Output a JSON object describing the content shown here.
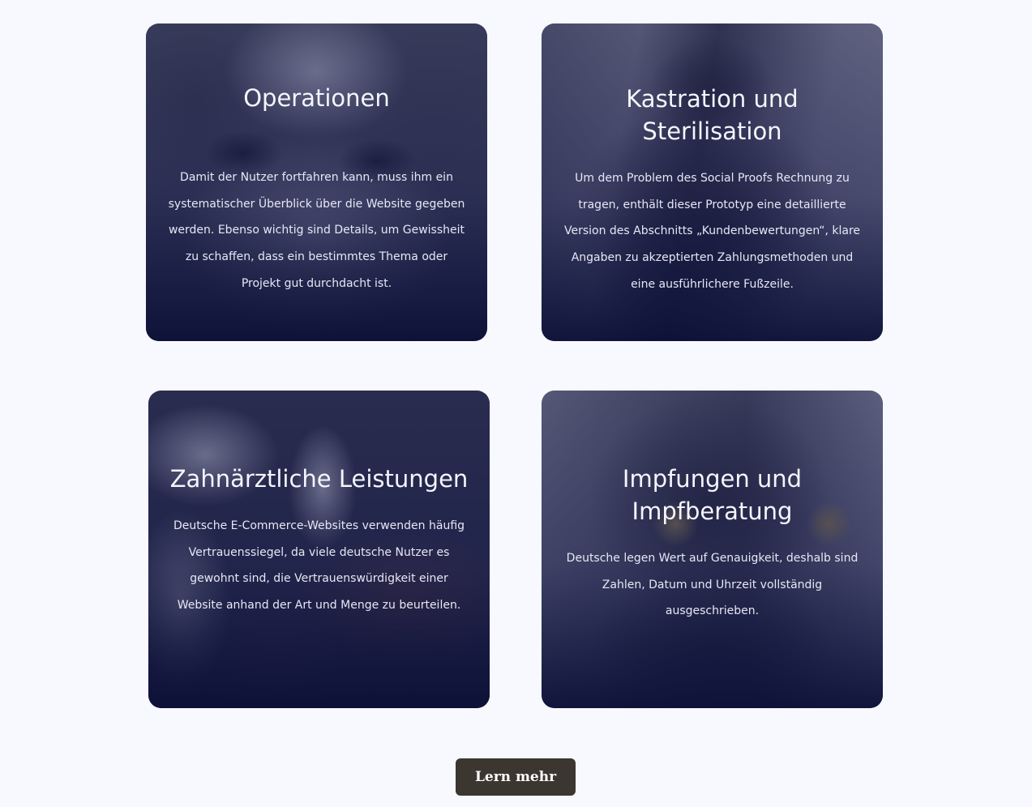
{
  "cards": [
    {
      "title": "Operationen",
      "text": "Damit der Nutzer fortfahren kann, muss ihm ein systematischer Überblick über die Website gegeben werden. Ebenso wichtig sind Details, um Gewissheit zu schaffen, dass ein bestimmtes Thema oder Projekt gut durchdacht ist."
    },
    {
      "title": "Kastration und Sterilisation",
      "text": "Um dem Problem des Social Proofs Rechnung zu tragen, enthält dieser Prototyp eine detaillierte Version des Abschnitts „Kundenbewertungen“, klare Angaben zu akzeptierten Zahlungsmethoden und eine ausführlichere Fußzeile."
    },
    {
      "title": "Zahnärztliche Leistungen",
      "text": "Deutsche E-Commerce-Websites verwenden häufig Vertrauenssiegel, da viele deutsche Nutzer es gewohnt sind, die Vertrauenswürdigkeit einer Website anhand der Art und Menge zu beurteilen."
    },
    {
      "title": "Impfungen und Impfberatung",
      "text": "Deutsche legen Wert auf Genauigkeit, deshalb sind Zahlen, Datum und Uhrzeit vollständig ausgeschrieben."
    }
  ],
  "cta": {
    "label": "Lern mehr",
    "color": "#3b3630"
  },
  "colors": {
    "page_background": "#f8f9fe",
    "card_overlay": "#0c1038"
  }
}
